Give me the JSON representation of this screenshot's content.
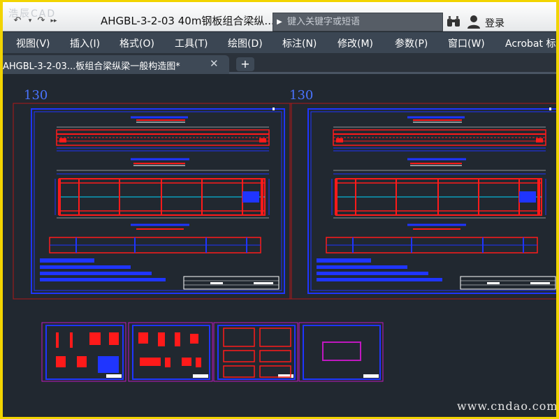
{
  "titlebar": {
    "logo_text": "浩辰CAD",
    "doc_title": "AHGBL-3-2-03 40m钢板组合梁纵...",
    "search_placeholder": "键入关键字或短语",
    "login_label": "登录"
  },
  "menu": {
    "items": [
      "视图(V)",
      "插入(I)",
      "格式(O)",
      "工具(T)",
      "绘图(D)",
      "标注(N)",
      "修改(M)",
      "参数(P)",
      "窗口(W)",
      "Acrobat 标"
    ]
  },
  "tabs": {
    "active_label": "AHGBL-3-2-03...板组合梁纵梁一般构造图*",
    "close_glyph": "✕",
    "new_glyph": "+"
  },
  "drawing": {
    "layout_numbers": [
      "130",
      "130"
    ]
  },
  "watermark": "www.cndao.com",
  "colors": {
    "frame_blue": "#1f35ff",
    "beam_red": "#ff1a1a",
    "cyan": "#00d8ff",
    "magenta": "#c018c0",
    "white": "#ffffff",
    "background": "#212830",
    "accent_border": "#f2d400"
  }
}
